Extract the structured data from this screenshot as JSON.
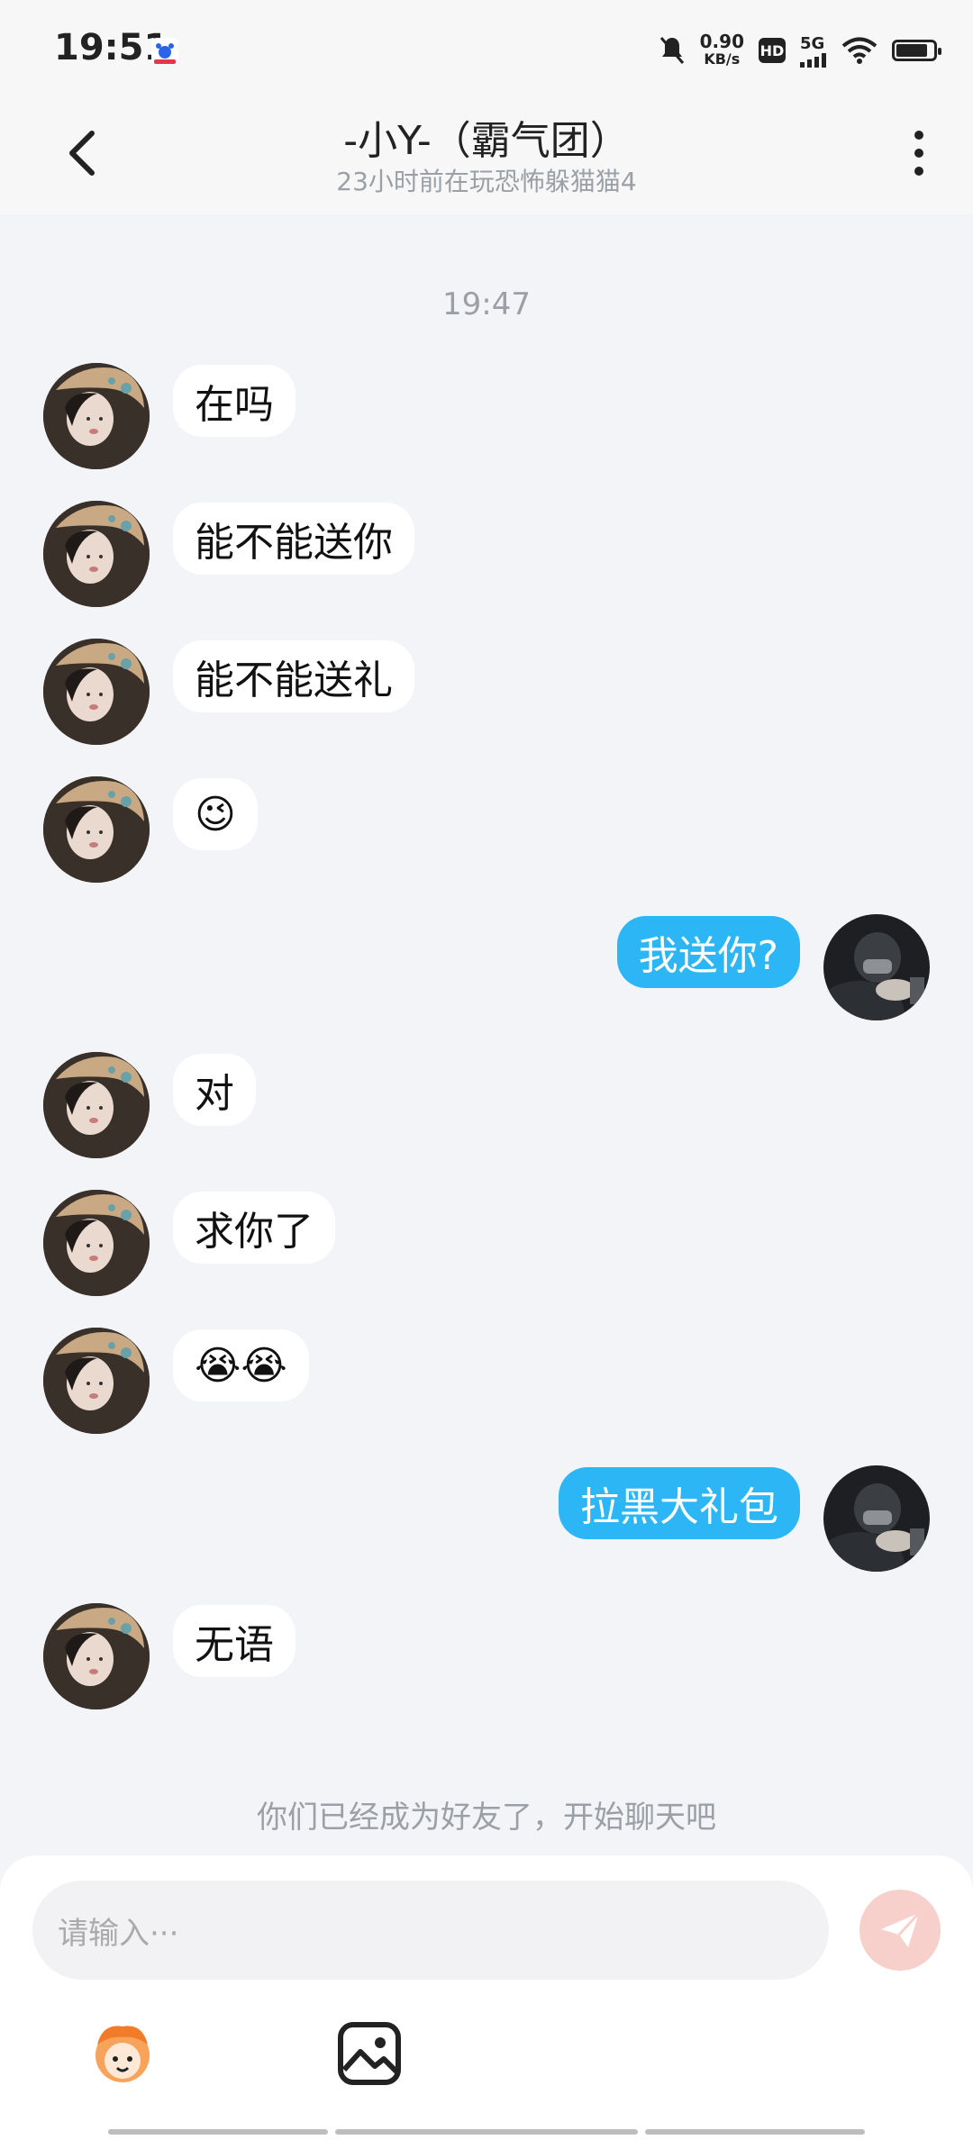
{
  "status_bar": {
    "time": "19:51",
    "speed_value": "0.90",
    "speed_unit": "KB/s",
    "hd": "HD",
    "network": "5G",
    "battery_level": 0.85,
    "icons": [
      "baidu-icon",
      "mute-icon",
      "signal-icon",
      "wifi-icon",
      "battery-icon"
    ]
  },
  "header": {
    "title": "-小Y-（霸气团）",
    "subtitle": "23小时前在玩恐怖躲猫猫4"
  },
  "chat": {
    "timestamp": "19:47",
    "messages": [
      {
        "side": "in",
        "text": "在吗"
      },
      {
        "side": "in",
        "text": "能不能送你"
      },
      {
        "side": "in",
        "text": "能不能送礼"
      },
      {
        "side": "in",
        "text": "😉"
      },
      {
        "side": "out",
        "text": "我送你?"
      },
      {
        "side": "in",
        "text": "对"
      },
      {
        "side": "in",
        "text": "求你了"
      },
      {
        "side": "in",
        "text": "😭😭"
      },
      {
        "side": "out",
        "text": "拉黑大礼包"
      },
      {
        "side": "in",
        "text": "无语"
      }
    ],
    "notice": "你们已经成为好友了，开始聊天吧"
  },
  "composer": {
    "placeholder": "请输入···",
    "send_icon": "send-icon",
    "tools": [
      "emoji-sticker-icon",
      "image-icon"
    ]
  },
  "colors": {
    "outgoing_bubble": "#2cb6f6",
    "incoming_bubble": "#ffffff",
    "send_button": "#f7d0cc"
  }
}
